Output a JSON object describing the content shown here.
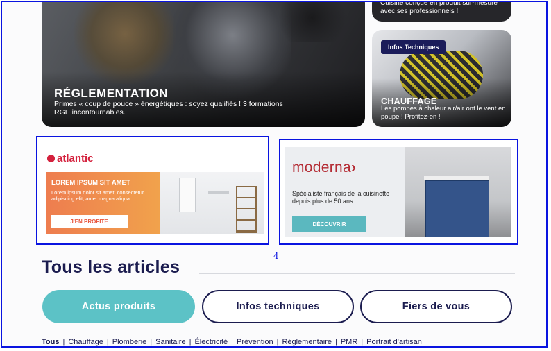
{
  "cards": {
    "main": {
      "title": "RÉGLEMENTATION",
      "description": "Primes « coup de pouce » énergétiques : soyez qualifiés ! 3 formations RGE incontournables."
    },
    "top_right": {
      "description": "Cuisine conçue en produit sur-mesure avec ses professionnels !"
    },
    "heating": {
      "badge": "Infos Techniques",
      "title": "CHAUFFAGE",
      "description": "Les pompes à chaleur air/air ont le vent en poupe ! Profitez-en !"
    }
  },
  "ads": {
    "atlantic": {
      "logo": "atlantic",
      "heading": "LOREM IPSUM SIT AMET",
      "text": "Lorem ipsum dolor sit amet, consectetur adipiscing elit, amet magna aliqua.",
      "button": "J'EN PROFITE"
    },
    "moderna": {
      "logo": "moderna",
      "text": "Spécialiste français de la cuisinette depuis plus de 50 ans",
      "button": "DÉCOUVRIR"
    }
  },
  "page_number": "4",
  "section": {
    "title": "Tous les articles"
  },
  "tabs": [
    {
      "label": "Actus produits",
      "active": true
    },
    {
      "label": "Infos techniques",
      "active": false
    },
    {
      "label": "Fiers de vous",
      "active": false
    }
  ],
  "filters": [
    {
      "label": "Tous",
      "active": true
    },
    {
      "label": "Chauffage"
    },
    {
      "label": "Plomberie"
    },
    {
      "label": "Sanitaire"
    },
    {
      "label": "Électricité"
    },
    {
      "label": "Prévention"
    },
    {
      "label": "Réglementaire"
    },
    {
      "label": "PMR"
    },
    {
      "label": "Portrait d'artisan"
    }
  ],
  "colors": {
    "navy": "#1b1c4f",
    "teal": "#5cc2c6",
    "outline_blue": "#0a14e0",
    "atlantic_red": "#d4213d",
    "moderna_red": "#b42b34"
  }
}
